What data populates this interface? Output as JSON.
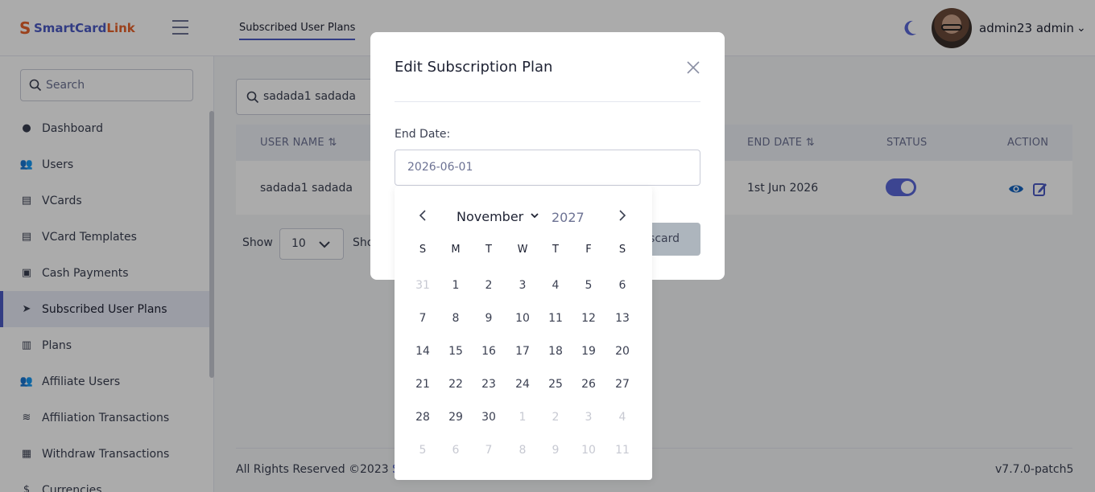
{
  "brand": {
    "part1": "SmartCard",
    "part2": "Link",
    "accent": "#4b5ac4",
    "accent2": "#e8632c"
  },
  "header": {
    "tab": "Subscribed User Plans",
    "user_name": "admin23 admin"
  },
  "sidebar": {
    "search_placeholder": "Search",
    "items": [
      {
        "label": "Dashboard",
        "icon": "dashboard-icon"
      },
      {
        "label": "Users",
        "icon": "users-icon"
      },
      {
        "label": "VCards",
        "icon": "vcard-icon"
      },
      {
        "label": "VCard Templates",
        "icon": "vcard-template-icon"
      },
      {
        "label": "Cash Payments",
        "icon": "cash-icon"
      },
      {
        "label": "Subscribed User Plans",
        "icon": "paper-plane-icon"
      },
      {
        "label": "Plans",
        "icon": "plans-icon"
      },
      {
        "label": "Affiliate Users",
        "icon": "users-icon"
      },
      {
        "label": "Affiliation Transactions",
        "icon": "coins-icon"
      },
      {
        "label": "Withdraw Transactions",
        "icon": "receipt-icon"
      },
      {
        "label": "Currencies",
        "icon": "dollar-icon"
      }
    ]
  },
  "main": {
    "search_value": "sadada1 sadada",
    "table": {
      "columns": [
        "USER NAME",
        "END DATE",
        "STATUS",
        "ACTION"
      ],
      "rows": [
        {
          "user_name": "sadada1 sadada",
          "end_date": "1st Jun 2026",
          "status": true
        }
      ]
    },
    "show_label": "Show",
    "show_value": "10",
    "show_label2": "Sho"
  },
  "footer": {
    "copyright": "All Rights Reserved ©2023 ",
    "link": "Sr",
    "version": "v7.7.0-patch5"
  },
  "modal": {
    "title": "Edit Subscription Plan",
    "field_label": "End Date:",
    "date_value": "2026-06-01",
    "discard_label": "scard"
  },
  "calendar": {
    "month": "November",
    "year": "2027",
    "weekdays": [
      "S",
      "M",
      "T",
      "W",
      "T",
      "F",
      "S"
    ],
    "weeks": [
      [
        "31",
        "1",
        "2",
        "3",
        "4",
        "5",
        "6"
      ],
      [
        "7",
        "8",
        "9",
        "10",
        "11",
        "12",
        "13"
      ],
      [
        "14",
        "15",
        "16",
        "17",
        "18",
        "19",
        "20"
      ],
      [
        "21",
        "22",
        "23",
        "24",
        "25",
        "26",
        "27"
      ],
      [
        "28",
        "29",
        "30",
        "1",
        "2",
        "3",
        "4"
      ],
      [
        "5",
        "6",
        "7",
        "8",
        "9",
        "10",
        "11"
      ]
    ],
    "muted": [
      [
        0,
        0
      ],
      [
        4,
        3
      ],
      [
        4,
        4
      ],
      [
        4,
        5
      ],
      [
        4,
        6
      ],
      [
        5,
        0
      ],
      [
        5,
        1
      ],
      [
        5,
        2
      ],
      [
        5,
        3
      ],
      [
        5,
        4
      ],
      [
        5,
        5
      ],
      [
        5,
        6
      ]
    ]
  }
}
